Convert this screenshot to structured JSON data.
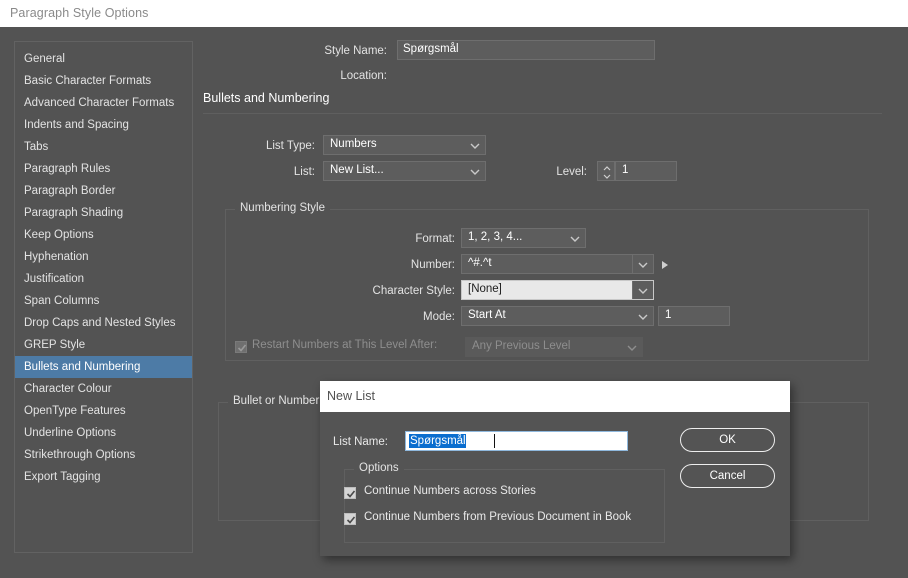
{
  "window": {
    "title": "Paragraph Style Options"
  },
  "sidebar": {
    "items": [
      {
        "label": "General",
        "selected": false
      },
      {
        "label": "Basic Character Formats",
        "selected": false
      },
      {
        "label": "Advanced Character Formats",
        "selected": false
      },
      {
        "label": "Indents and Spacing",
        "selected": false
      },
      {
        "label": "Tabs",
        "selected": false
      },
      {
        "label": "Paragraph Rules",
        "selected": false
      },
      {
        "label": "Paragraph Border",
        "selected": false
      },
      {
        "label": "Paragraph Shading",
        "selected": false
      },
      {
        "label": "Keep Options",
        "selected": false
      },
      {
        "label": "Hyphenation",
        "selected": false
      },
      {
        "label": "Justification",
        "selected": false
      },
      {
        "label": "Span Columns",
        "selected": false
      },
      {
        "label": "Drop Caps and Nested Styles",
        "selected": false
      },
      {
        "label": "GREP Style",
        "selected": false
      },
      {
        "label": "Bullets and Numbering",
        "selected": true
      },
      {
        "label": "Character Colour",
        "selected": false
      },
      {
        "label": "OpenType Features",
        "selected": false
      },
      {
        "label": "Underline Options",
        "selected": false
      },
      {
        "label": "Strikethrough Options",
        "selected": false
      },
      {
        "label": "Export Tagging",
        "selected": false
      }
    ]
  },
  "header": {
    "style_name_label": "Style Name:",
    "style_name_value": "Spørgsmål",
    "location_label": "Location:",
    "location_value": ""
  },
  "panel": {
    "title": "Bullets and Numbering",
    "list_type_label": "List Type:",
    "list_type_value": "Numbers",
    "list_label": "List:",
    "list_value": "New List...",
    "level_label": "Level:",
    "level_value": "1"
  },
  "numbering_style": {
    "group_title": "Numbering Style",
    "format_label": "Format:",
    "format_value": "1, 2, 3, 4...",
    "number_label": "Number:",
    "number_value": "^#.^t",
    "character_style_label": "Character Style:",
    "character_style_value": "[None]",
    "mode_label": "Mode:",
    "mode_value": "Start At",
    "mode_number_value": "1",
    "restart_label": "Restart Numbers at This Level After:",
    "restart_checked": true,
    "restart_value": "Any Previous Level"
  },
  "bullet_position": {
    "group_title": "Bullet or Numbering Position"
  },
  "modal": {
    "title": "New List",
    "list_name_label": "List Name:",
    "list_name_value": "Spørgsmål",
    "options_group_title": "Options",
    "option1_label": "Continue Numbers across Stories",
    "option1_checked": true,
    "option2_label": "Continue Numbers from Previous Document in Book",
    "option2_checked": true,
    "ok_label": "OK",
    "cancel_label": "Cancel"
  },
  "colors": {
    "dialog_bg": "#535353",
    "titlebar_bg": "#ffffff",
    "selection_blue": "#4d7ba6",
    "text_selection_blue": "#0b6ecf",
    "field_bg": "#5d5d5d",
    "light_field_bg": "#e8e8e8"
  }
}
